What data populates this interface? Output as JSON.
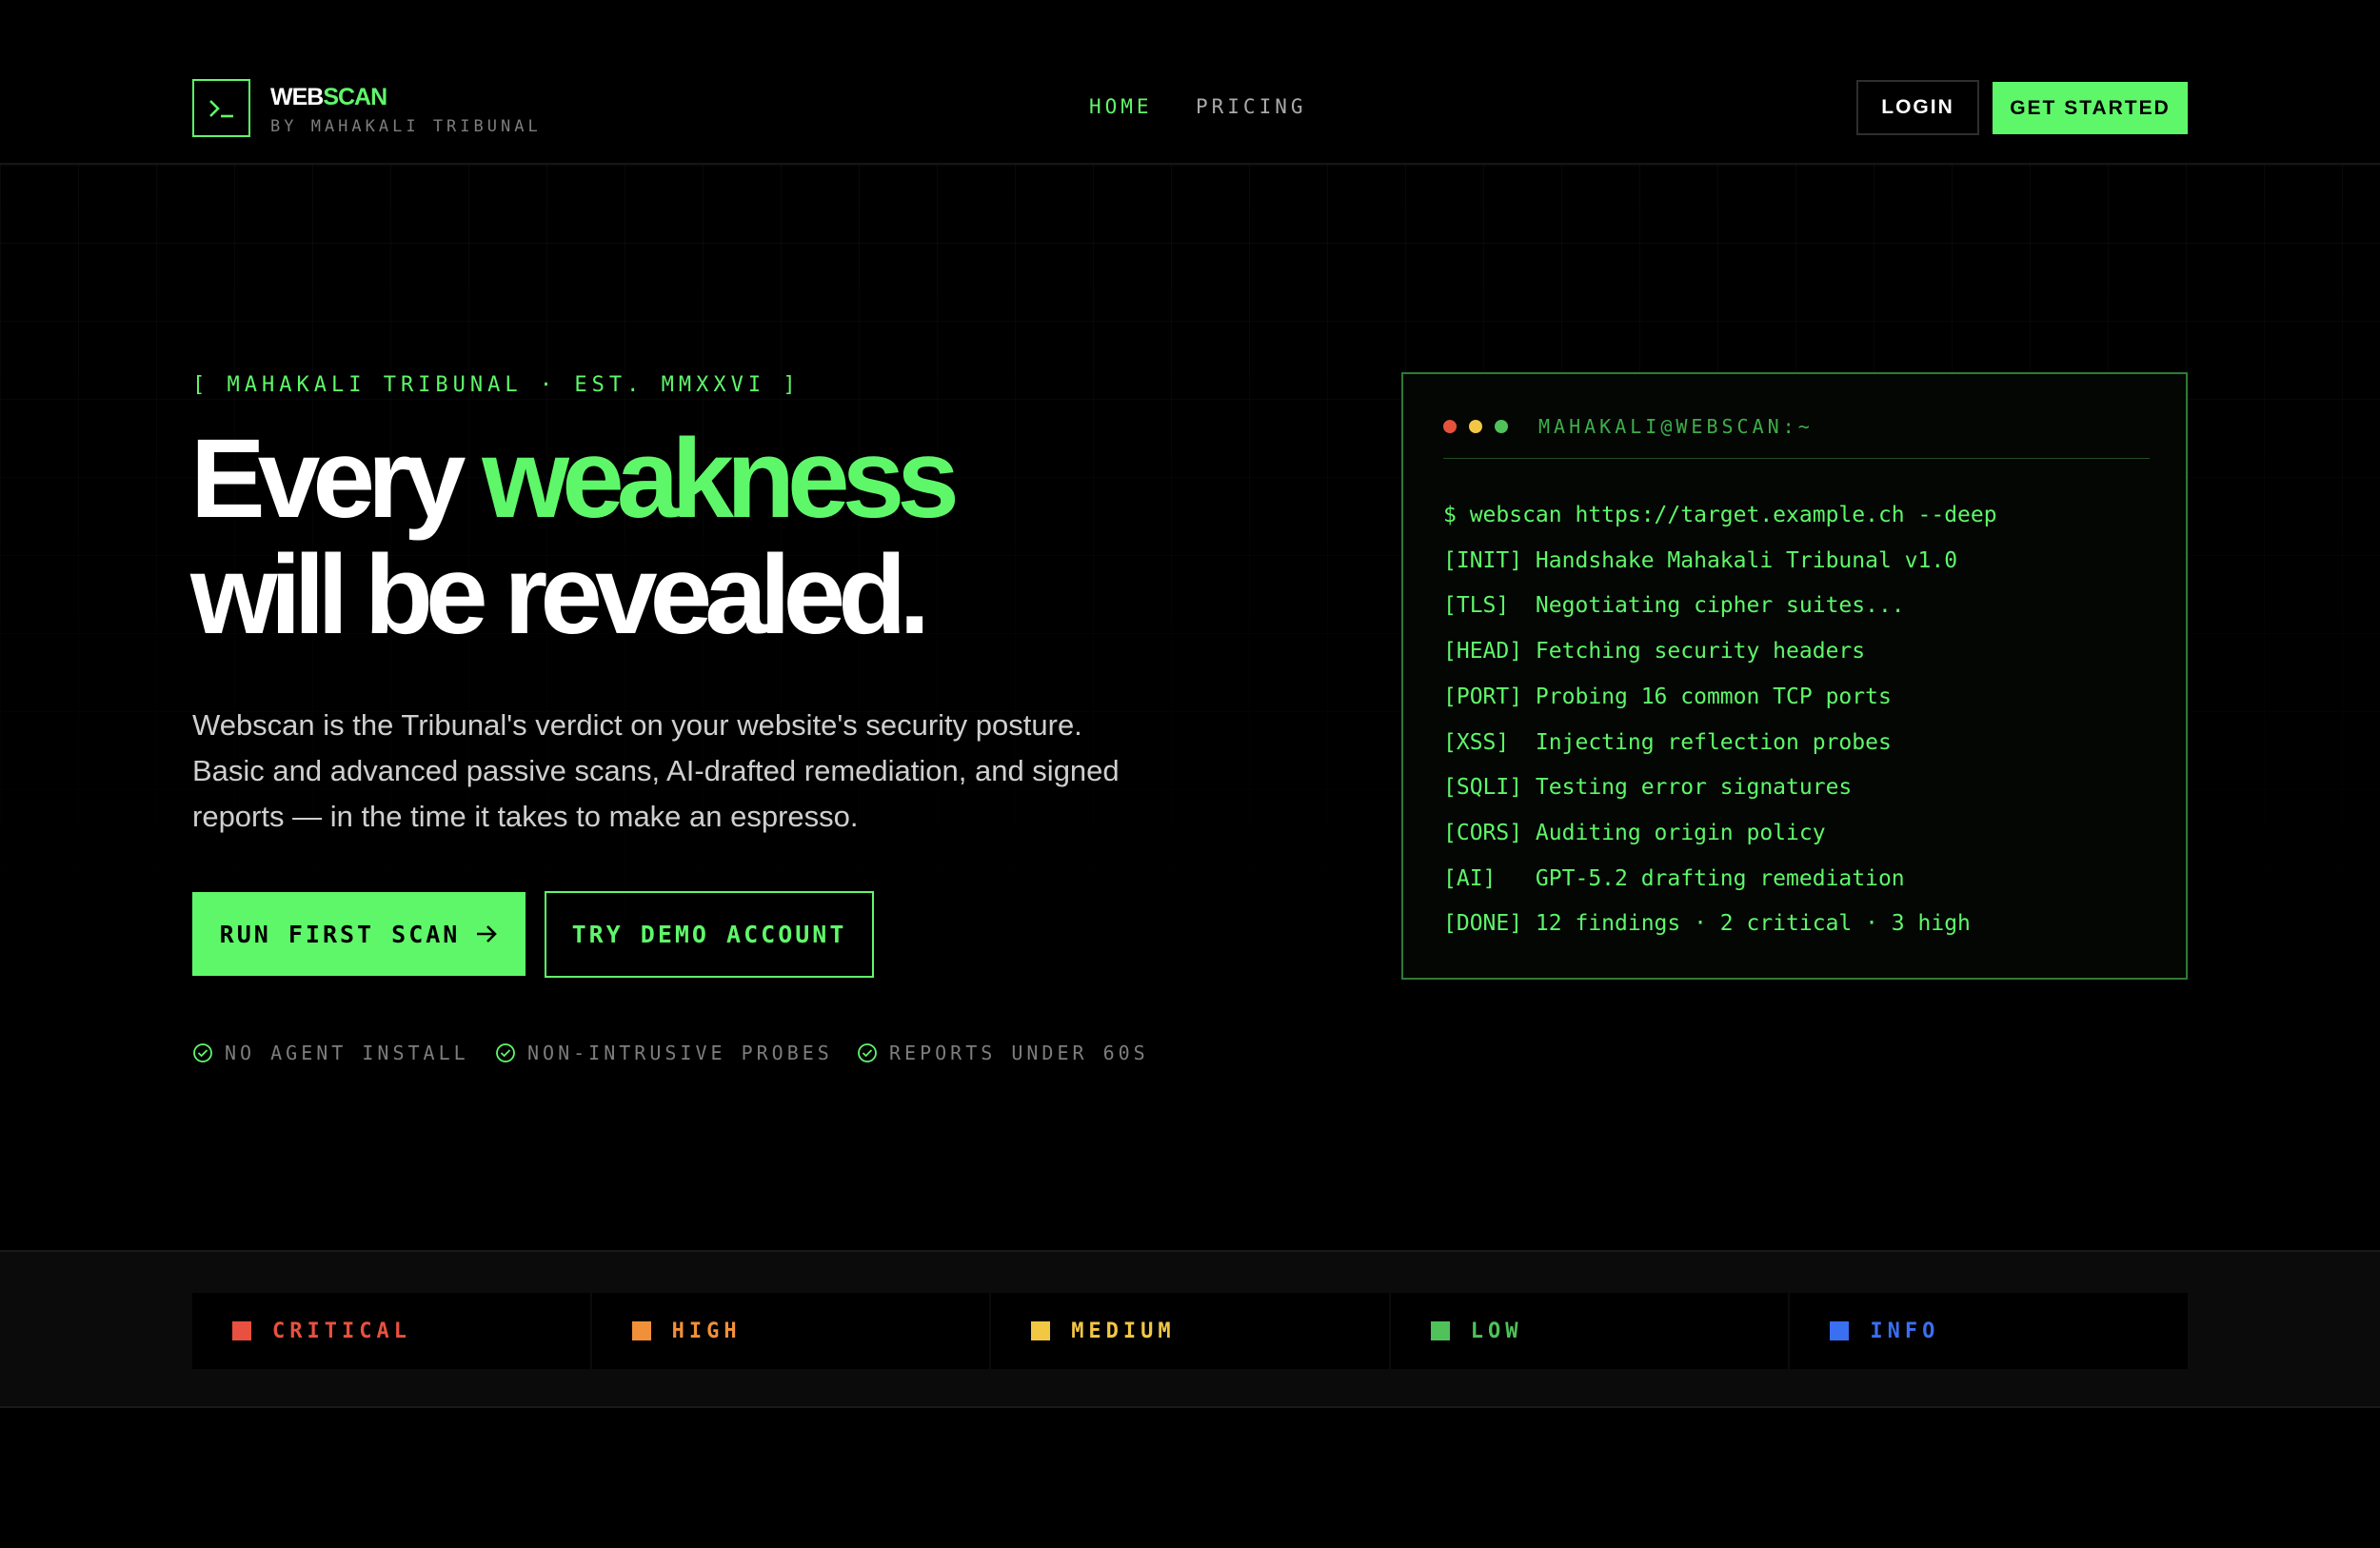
{
  "header": {
    "brand_part1": "WEB",
    "brand_part2": "SCAN",
    "brand_sub": "BY MAHAKALI TRIBUNAL",
    "nav": [
      {
        "label": "HOME",
        "active": true
      },
      {
        "label": "PRICING",
        "active": false
      }
    ],
    "login_label": "LOGIN",
    "get_started_label": "GET STARTED"
  },
  "hero": {
    "eyebrow": "[ MAHAKALI TRIBUNAL · EST. MMXXVI ]",
    "headline_part1": "Every ",
    "headline_highlight": "weakness",
    "headline_line2": "will be revealed.",
    "description": "Webscan is the Tribunal's verdict on your website's security posture. Basic and advanced passive scans, AI-drafted remediation, and signed reports — in the time it takes to make an espresso.",
    "primary_cta": "RUN FIRST SCAN",
    "secondary_cta": "TRY DEMO ACCOUNT",
    "features": [
      "NO AGENT INSTALL",
      "NON-INTRUSIVE PROBES",
      "REPORTS UNDER 60S"
    ]
  },
  "terminal": {
    "title": "MAHAKALI@WEBSCAN:~",
    "dot_colors": [
      "#e5533d",
      "#f2c744",
      "#4fc25a"
    ],
    "lines": [
      "$ webscan https://target.example.ch --deep",
      "[INIT] Handshake Mahakali Tribunal v1.0",
      "[TLS]  Negotiating cipher suites...",
      "[HEAD] Fetching security headers",
      "[PORT] Probing 16 common TCP ports",
      "[XSS]  Injecting reflection probes",
      "[SQLI] Testing error signatures",
      "[CORS] Auditing origin policy",
      "[AI]   GPT-5.2 drafting remediation",
      "[DONE] 12 findings · 2 critical · 3 high"
    ]
  },
  "severity": [
    {
      "label": "CRITICAL",
      "color": "#e8513f"
    },
    {
      "label": "HIGH",
      "color": "#f0913a"
    },
    {
      "label": "MEDIUM",
      "color": "#f2c744"
    },
    {
      "label": "LOW",
      "color": "#4fc25a"
    },
    {
      "label": "INFO",
      "color": "#3b6ff2"
    }
  ],
  "colors": {
    "accent": "#5ff76a",
    "background": "#000000"
  }
}
